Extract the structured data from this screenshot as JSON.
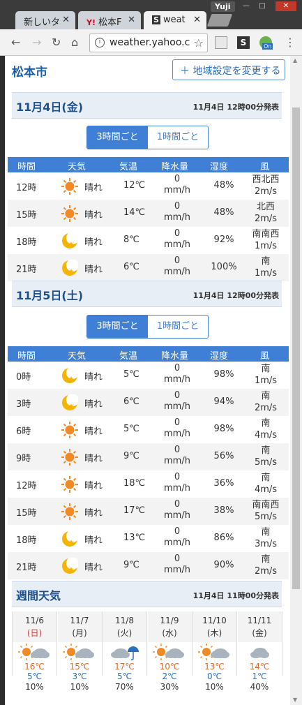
{
  "window": {
    "user": "Yuji",
    "tabs": [
      {
        "label": "新しいタ",
        "active": false
      },
      {
        "label": "松本F",
        "favicon": "Y!",
        "active": false
      },
      {
        "label": "weat",
        "favicon": "S",
        "active": true
      }
    ]
  },
  "toolbar": {
    "url": "weather.yahoo.c",
    "ext_badge": "On"
  },
  "header": {
    "city": "松本市",
    "settings_button": "地域設定を変更する"
  },
  "day1": {
    "date": "11月4日(金)",
    "issued": "11月4日 12時00分発表",
    "toggle": [
      "3時間ごと",
      "1時間ごと"
    ],
    "columns": [
      "時間",
      "天気",
      "気温",
      "降水量",
      "湿度",
      "風"
    ],
    "rows": [
      {
        "time": "12時",
        "icon": "sun-icon",
        "weather": "晴れ",
        "temp": "12℃",
        "rain_value": "0",
        "rain_unit": "mm/h",
        "humidity": "48%",
        "wind_dir": "西北西",
        "wind_speed": "2m/s"
      },
      {
        "time": "15時",
        "icon": "sun-icon",
        "weather": "晴れ",
        "temp": "14℃",
        "rain_value": "0",
        "rain_unit": "mm/h",
        "humidity": "48%",
        "wind_dir": "北西",
        "wind_speed": "2m/s"
      },
      {
        "time": "18時",
        "icon": "moon-icon",
        "weather": "晴れ",
        "temp": "8℃",
        "rain_value": "0",
        "rain_unit": "mm/h",
        "humidity": "92%",
        "wind_dir": "南南西",
        "wind_speed": "1m/s"
      },
      {
        "time": "21時",
        "icon": "moon-icon",
        "weather": "晴れ",
        "temp": "6℃",
        "rain_value": "0",
        "rain_unit": "mm/h",
        "humidity": "100%",
        "wind_dir": "南",
        "wind_speed": "1m/s"
      }
    ]
  },
  "day2": {
    "date": "11月5日(土)",
    "issued": "11月4日 12時00分発表",
    "toggle": [
      "3時間ごと",
      "1時間ごと"
    ],
    "columns": [
      "時間",
      "天気",
      "気温",
      "降水量",
      "湿度",
      "風"
    ],
    "rows": [
      {
        "time": "0時",
        "icon": "moon-icon",
        "weather": "晴れ",
        "temp": "5℃",
        "rain_value": "0",
        "rain_unit": "mm/h",
        "humidity": "98%",
        "wind_dir": "南",
        "wind_speed": "1m/s"
      },
      {
        "time": "3時",
        "icon": "moon-icon",
        "weather": "晴れ",
        "temp": "6℃",
        "rain_value": "0",
        "rain_unit": "mm/h",
        "humidity": "94%",
        "wind_dir": "南",
        "wind_speed": "2m/s"
      },
      {
        "time": "6時",
        "icon": "sun-icon",
        "weather": "晴れ",
        "temp": "5℃",
        "rain_value": "0",
        "rain_unit": "mm/h",
        "humidity": "98%",
        "wind_dir": "南",
        "wind_speed": "4m/s"
      },
      {
        "time": "9時",
        "icon": "sun-icon",
        "weather": "晴れ",
        "temp": "9℃",
        "rain_value": "0",
        "rain_unit": "mm/h",
        "humidity": "56%",
        "wind_dir": "南",
        "wind_speed": "5m/s"
      },
      {
        "time": "12時",
        "icon": "sun-icon",
        "weather": "晴れ",
        "temp": "18℃",
        "rain_value": "0",
        "rain_unit": "mm/h",
        "humidity": "36%",
        "wind_dir": "南",
        "wind_speed": "4m/s"
      },
      {
        "time": "15時",
        "icon": "sun-icon",
        "weather": "晴れ",
        "temp": "17℃",
        "rain_value": "0",
        "rain_unit": "mm/h",
        "humidity": "38%",
        "wind_dir": "南南西",
        "wind_speed": "5m/s"
      },
      {
        "time": "18時",
        "icon": "moon-icon",
        "weather": "晴れ",
        "temp": "13℃",
        "rain_value": "0",
        "rain_unit": "mm/h",
        "humidity": "86%",
        "wind_dir": "南",
        "wind_speed": "3m/s"
      },
      {
        "time": "21時",
        "icon": "moon-icon",
        "weather": "晴れ",
        "temp": "9℃",
        "rain_value": "0",
        "rain_unit": "mm/h",
        "humidity": "90%",
        "wind_dir": "南",
        "wind_speed": "2m/s"
      }
    ]
  },
  "weekly": {
    "title": "週間天気",
    "issued": "11月4日 11時00分発表",
    "days": [
      {
        "date": "11/6",
        "dow": "(日)",
        "icon": "sun-cloud-icon",
        "high": "16℃",
        "low": "5℃",
        "pop": "10%"
      },
      {
        "date": "11/7",
        "dow": "(月)",
        "icon": "sun-cloud-icon",
        "high": "15℃",
        "low": "3℃",
        "pop": "10%"
      },
      {
        "date": "11/8",
        "dow": "(火)",
        "icon": "cloud-umbrella-icon",
        "high": "17℃",
        "low": "5℃",
        "pop": "70%"
      },
      {
        "date": "11/9",
        "dow": "(水)",
        "icon": "sun-cloud-icon",
        "high": "10℃",
        "low": "2℃",
        "pop": "30%"
      },
      {
        "date": "11/10",
        "dow": "(木)",
        "icon": "sun-cloud-icon",
        "high": "13℃",
        "low": "0℃",
        "pop": "10%"
      },
      {
        "date": "11/11",
        "dow": "(金)",
        "icon": "cloud-icon",
        "high": "14℃",
        "low": "1℃",
        "pop": "40%"
      }
    ]
  },
  "colors": {
    "accent": "#3f7fd6",
    "sun": "#f08a24",
    "moon": "#f5b400"
  }
}
